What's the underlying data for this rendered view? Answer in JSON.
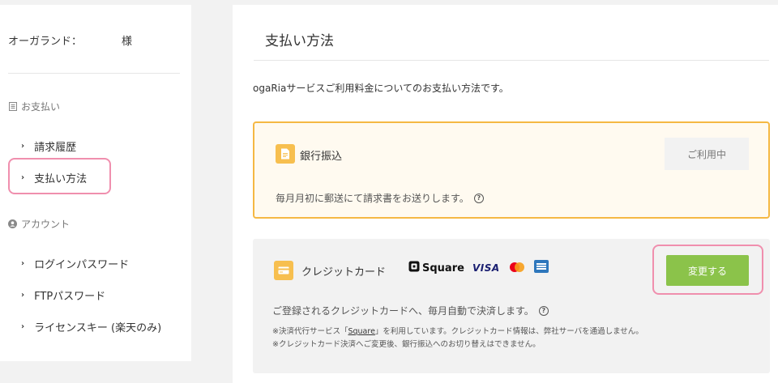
{
  "sidebar": {
    "user_label": "オーガランド：",
    "user_suffix": "様",
    "section_payment": "お支払い",
    "section_account": "アカウント",
    "items": [
      {
        "label": "請求履歴"
      },
      {
        "label": "支払い方法"
      },
      {
        "label": "ログインパスワード"
      },
      {
        "label": "FTPパスワード"
      },
      {
        "label": "ライセンスキー (楽天のみ)"
      }
    ]
  },
  "main": {
    "title": "支払い方法",
    "intro": "ogaRiaサービスご利用料金についてのお支払い方法です。",
    "bank": {
      "title": "銀行振込",
      "status_button": "ご利用中",
      "description": "毎月月初に郵送にて請求書をお送りします。"
    },
    "credit": {
      "title": "クレジットカード",
      "brand_square": "Square",
      "brand_visa": "VISA",
      "change_button": "変更する",
      "description": "ご登録されるクレジットカードへ、毎月自動で決済します。",
      "note1_prefix": "※決済代行サービス「",
      "note1_link": "Square",
      "note1_suffix": "」を利用しています。クレジットカード情報は、弊社サーバを通過しません。",
      "note2": "※クレジットカード決済へご変更後、銀行振込へのお切り替えはできません。"
    }
  },
  "colors": {
    "accent_orange": "#f5b843",
    "accent_green": "#8bc34a",
    "highlight_pink": "#f08fae"
  },
  "icons": [
    "list-icon",
    "user-circle-icon",
    "chevron-right-icon",
    "document-icon",
    "credit-card-icon",
    "help-icon",
    "square-logo-icon",
    "mastercard-icon",
    "amex-icon"
  ]
}
